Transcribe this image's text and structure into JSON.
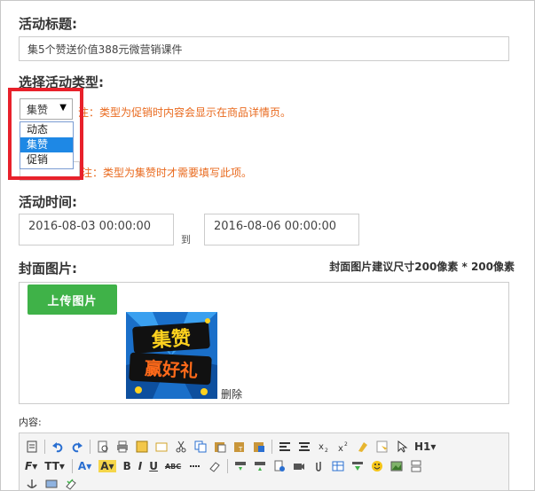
{
  "form": {
    "title_label": "活动标题:",
    "title_value": "集5个赞送价值388元微营销课件",
    "type_label": "选择活动类型:",
    "type_selected": "集赞",
    "type_arrow": "▼",
    "type_options": [
      "动态",
      "集赞",
      "促销"
    ],
    "type_note": "注：类型为促销时内容会显示在商品详情页。",
    "stub_note": "注：类型为集赞时才需要填写此项。",
    "time_label": "活动时间:",
    "start_time": "2016-08-03 00:00:00",
    "to_text": "到",
    "end_time": "2016-08-06 00:00:00",
    "cover_label": "封面图片:",
    "cover_hint": "封面图片建议尺寸200像素 * 200像素",
    "upload_button": "上传图片",
    "cover_image_text": [
      "集赞",
      "赢好礼"
    ],
    "delete_text": "删除",
    "content_label": "内容:"
  },
  "toolbar": {
    "row1": [
      "source-icon",
      "undo-icon",
      "redo-icon",
      "preview-icon",
      "print-icon",
      "template-icon",
      "code-icon",
      "cut-icon",
      "copy-icon",
      "paste-icon",
      "paste-plain-icon",
      "paste-word-icon",
      "align-left-icon",
      "align-center-icon",
      "subscript-icon",
      "superscript-icon",
      "clear-format-icon",
      "select-all-icon",
      "cursor-icon"
    ],
    "heading_label": "H1",
    "row2_font": "F",
    "row2_size": "TT",
    "row2_font_color": "A",
    "row2_highlight": "A",
    "row2_bold": "B",
    "row2_italic": "I",
    "row2_underline": "U",
    "row2_abc": "ABC"
  },
  "colors": {
    "accent_red": "#e8212b",
    "note_orange": "#e96a1e",
    "upload_green": "#3fb248",
    "selected_blue": "#1e88e5"
  }
}
